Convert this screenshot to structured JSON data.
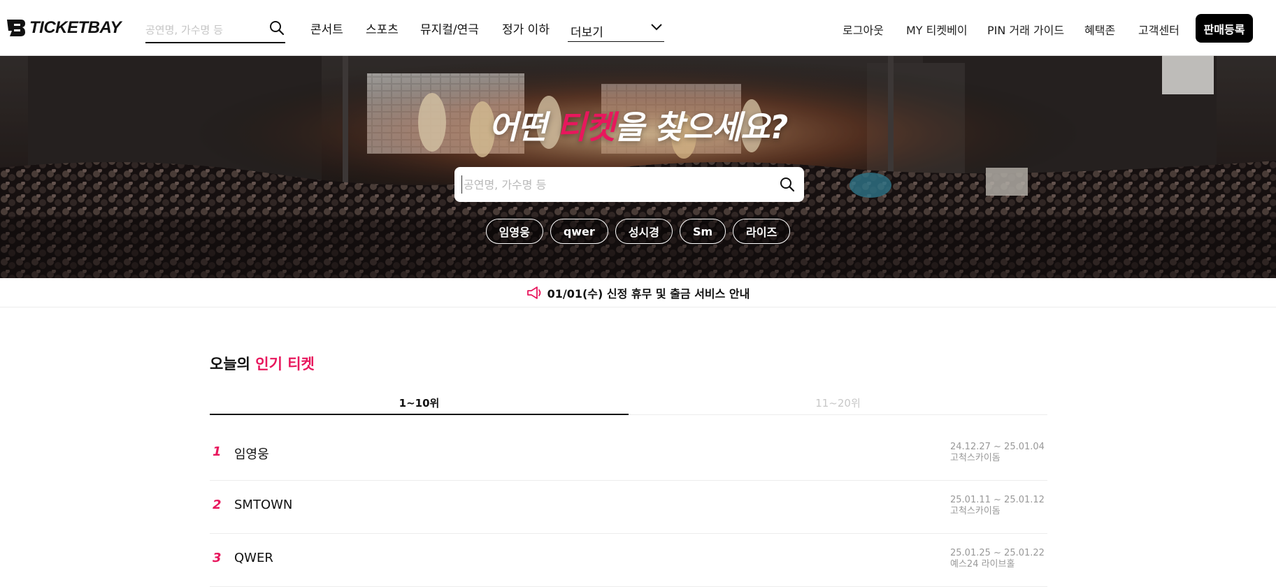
{
  "header": {
    "logo_text": "TICKETBAY",
    "search_placeholder": "공연명, 가수명 등",
    "nav": [
      {
        "label": "콘서트"
      },
      {
        "label": "스포츠"
      },
      {
        "label": "뮤지컬/연극"
      },
      {
        "label": "정가 이하"
      }
    ],
    "more_label": "더보기",
    "util": [
      {
        "label": "로그아웃"
      },
      {
        "label": "MY 티켓베이"
      },
      {
        "label": "PIN 거래 가이드"
      },
      {
        "label": "혜택존"
      },
      {
        "label": "고객센터"
      }
    ],
    "sell_label": "판매등록"
  },
  "hero": {
    "title_pre": "어떤 ",
    "title_accent": "티켓",
    "title_post": "을 찾으세요?",
    "search_placeholder": "공연명, 가수명 등",
    "chips": [
      "임영웅",
      "qwer",
      "성시경",
      "Sm",
      "라이즈"
    ]
  },
  "notice": {
    "text": "01/01(수) 신정 휴무 및 출금 서비스 안내"
  },
  "popular": {
    "title_pre": "오늘의 ",
    "title_accent": "인기 티켓",
    "tabs": [
      {
        "label": "1~10위",
        "active": true
      },
      {
        "label": "11~20위",
        "active": false
      }
    ],
    "items": [
      {
        "rank": "1",
        "name": "임영웅",
        "date": "24.12.27 ~ 25.01.04",
        "venue": "고척스카이돔"
      },
      {
        "rank": "2",
        "name": "SMTOWN",
        "date": "25.01.11 ~ 25.01.12",
        "venue": "고척스카이돔"
      },
      {
        "rank": "3",
        "name": "QWER",
        "date": "25.01.25 ~ 25.01.22",
        "venue": "예스24 라이브홀"
      }
    ]
  },
  "colors": {
    "accent": "#e8175d",
    "text": "#111111",
    "muted": "#999999"
  },
  "icons": {
    "header_search": "search-icon",
    "hero_search": "search-icon",
    "more": "chevron-down-icon",
    "notice": "megaphone-icon"
  }
}
